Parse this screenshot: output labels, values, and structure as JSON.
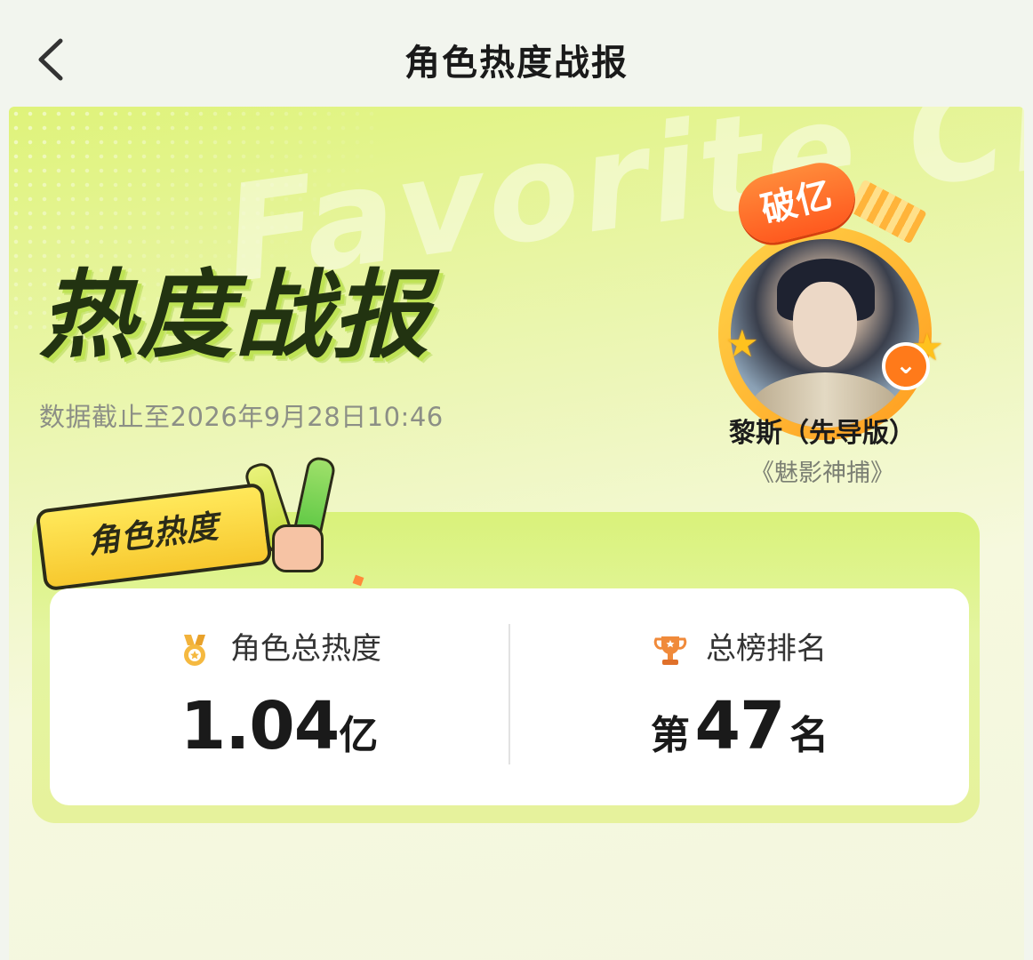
{
  "nav": {
    "title": "角色热度战报",
    "back_icon": "chevron-left-icon"
  },
  "hero": {
    "watermark": "Favorite Cha",
    "title": "热度战报",
    "timestamp": "数据截止至2026年9月28日10:46"
  },
  "character": {
    "badge": "破亿",
    "name": "黎斯（先导版）",
    "drama": "《魅影神捕》"
  },
  "panel": {
    "tag": "角色热度",
    "heat": {
      "label": "角色总热度",
      "value": "1.04",
      "unit": "亿",
      "icon": "medal-icon"
    },
    "rank": {
      "label": "总榜排名",
      "prefix": "第",
      "value": "47",
      "suffix": "名",
      "icon": "trophy-icon"
    }
  },
  "colors": {
    "accent_green": "#d9f27a",
    "accent_orange": "#ff7a1a",
    "tag_yellow": "#f7c82e"
  }
}
